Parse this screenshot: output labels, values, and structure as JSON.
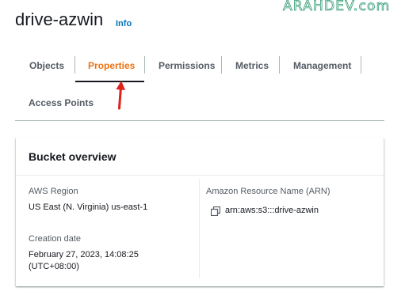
{
  "watermark": "ARAHDEV.com",
  "header": {
    "title": "drive-azwin",
    "info_label": "Info"
  },
  "tabs": [
    {
      "label": "Objects",
      "active": false
    },
    {
      "label": "Properties",
      "active": true
    },
    {
      "label": "Permissions",
      "active": false
    },
    {
      "label": "Metrics",
      "active": false
    },
    {
      "label": "Management",
      "active": false
    },
    {
      "label": "Access Points",
      "active": false
    }
  ],
  "bucket_overview": {
    "title": "Bucket overview",
    "region_label": "AWS Region",
    "region_value": "US East (N. Virginia) us-east-1",
    "creation_label": "Creation date",
    "creation_value_line1": "February 27, 2023, 14:08:25",
    "creation_value_line2": "(UTC+08:00)",
    "arn_label": "Amazon Resource Name (ARN)",
    "arn_value": "arn:aws:s3:::drive-azwin"
  },
  "colors": {
    "active_tab": "#ec7211",
    "link": "#0073bb",
    "annotation_arrow": "#e0201b",
    "watermark": "#2f9a73"
  }
}
